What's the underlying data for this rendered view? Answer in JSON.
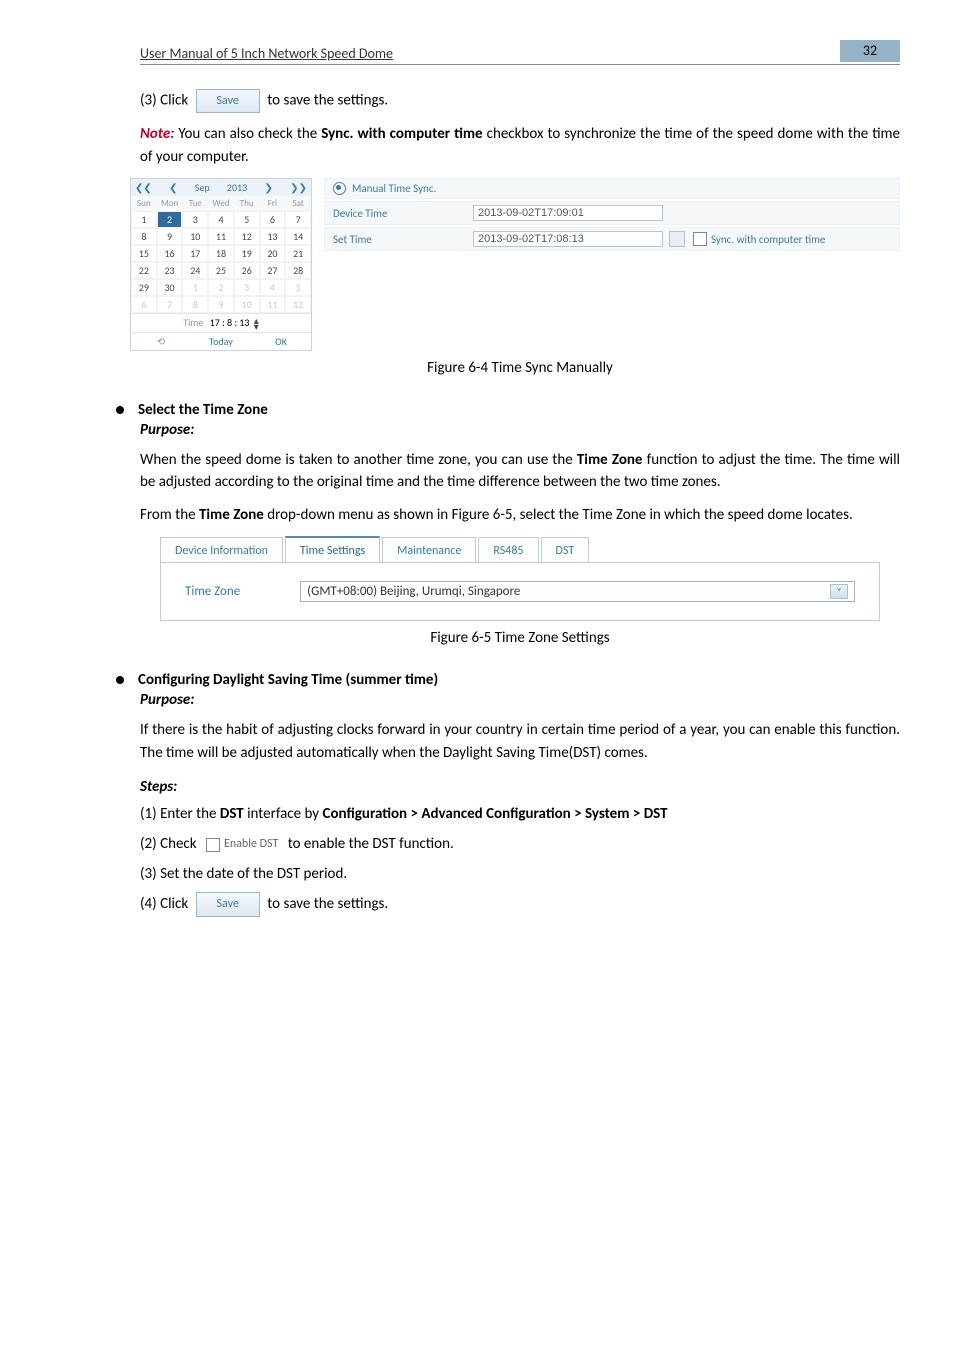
{
  "header": {
    "title": "User Manual of 5 Inch Network Speed Dome",
    "page_number": "32"
  },
  "intro": {
    "step3_prefix": "(3)  Click",
    "save_label": "Save",
    "step3_suffix": "to save the settings.",
    "note_label": "Note:",
    "note_text_1": " You can also check the ",
    "note_bold": "Sync. with computer time",
    "note_text_2": " checkbox to synchronize the time of the speed dome with the time of your computer."
  },
  "calendar": {
    "month": "Sep",
    "year": "2013",
    "nav_prev_fast": "❮❮",
    "nav_prev": "❮",
    "nav_next": "❯",
    "nav_next_fast": "❯❯",
    "dow": [
      "Sun",
      "Mon",
      "Tue",
      "Wed",
      "Thu",
      "Fri",
      "Sat"
    ],
    "weeks": [
      [
        {
          "n": "1",
          "muted": false
        },
        {
          "n": "2",
          "selected": true
        },
        {
          "n": "3"
        },
        {
          "n": "4"
        },
        {
          "n": "5"
        },
        {
          "n": "6"
        },
        {
          "n": "7"
        }
      ],
      [
        {
          "n": "8"
        },
        {
          "n": "9"
        },
        {
          "n": "10"
        },
        {
          "n": "11"
        },
        {
          "n": "12"
        },
        {
          "n": "13"
        },
        {
          "n": "14"
        }
      ],
      [
        {
          "n": "15"
        },
        {
          "n": "16"
        },
        {
          "n": "17"
        },
        {
          "n": "18"
        },
        {
          "n": "19"
        },
        {
          "n": "20"
        },
        {
          "n": "21"
        }
      ],
      [
        {
          "n": "22"
        },
        {
          "n": "23"
        },
        {
          "n": "24"
        },
        {
          "n": "25"
        },
        {
          "n": "26"
        },
        {
          "n": "27"
        },
        {
          "n": "28"
        }
      ],
      [
        {
          "n": "29"
        },
        {
          "n": "30"
        },
        {
          "n": "1",
          "muted": true
        },
        {
          "n": "2",
          "muted": true
        },
        {
          "n": "3",
          "muted": true
        },
        {
          "n": "4",
          "muted": true
        },
        {
          "n": "5",
          "muted": true
        }
      ],
      [
        {
          "n": "6",
          "muted": true
        },
        {
          "n": "7",
          "muted": true
        },
        {
          "n": "8",
          "muted": true
        },
        {
          "n": "9",
          "muted": true
        },
        {
          "n": "10",
          "muted": true
        },
        {
          "n": "11",
          "muted": true
        },
        {
          "n": "12",
          "muted": true
        }
      ]
    ],
    "time_label": "Time",
    "time_value": "17 :  8  : 13",
    "clear": "⟲",
    "today": "Today",
    "ok": "OK"
  },
  "sync": {
    "manual_label": "Manual Time Sync.",
    "device_time_label": "Device Time",
    "device_time_value": "2013-09-02T17:09:01",
    "set_time_label": "Set Time",
    "set_time_value": "2013-09-02T17:08:13",
    "sync_checkbox_label": "Sync. with computer time"
  },
  "caption1": "Figure 6-4 Time Sync Manually",
  "section_tz": {
    "heading": "Select the Time Zone",
    "purpose": "Purpose:",
    "p1a": "When the speed dome is taken to another time zone, you can use the ",
    "p1b": "Time Zone",
    "p1c": " function to adjust the time. The time will be adjusted according to the original time and the time difference between the two time zones.",
    "p2a": "From the ",
    "p2b": "Time Zone",
    "p2c": " drop-down menu as shown in Figure 6-5, select the Time Zone in which the speed dome locates."
  },
  "tabs": {
    "items": [
      "Device Information",
      "Time Settings",
      "Maintenance",
      "RS485",
      "DST"
    ],
    "active_index": 1,
    "tz_label": "Time Zone",
    "tz_value": "(GMT+08:00) Beijing, Urumqi, Singapore"
  },
  "caption2": "Figure 6-5 Time Zone Settings",
  "section_dst": {
    "heading": "Configuring Daylight Saving Time (summer time)",
    "purpose": "Purpose:",
    "p1": "If there is the habit of adjusting clocks forward in your country in certain time period of a year, you can enable this function. The time will be adjusted automatically when the Daylight Saving Time(DST) comes.",
    "steps_label": "Steps:",
    "s1a": "(1) Enter the ",
    "s1b": "DST",
    "s1c": " interface by ",
    "s1d": "Configuration > Advanced Configuration > System > DST",
    "s2a": "(2)  Check",
    "s2_enable": "Enable DST",
    "s2b": "to enable the DST function.",
    "s3": "(3)  Set the date of the DST period.",
    "s4a": "(4)  Click",
    "s4_save": "Save",
    "s4b": "to save the settings."
  }
}
